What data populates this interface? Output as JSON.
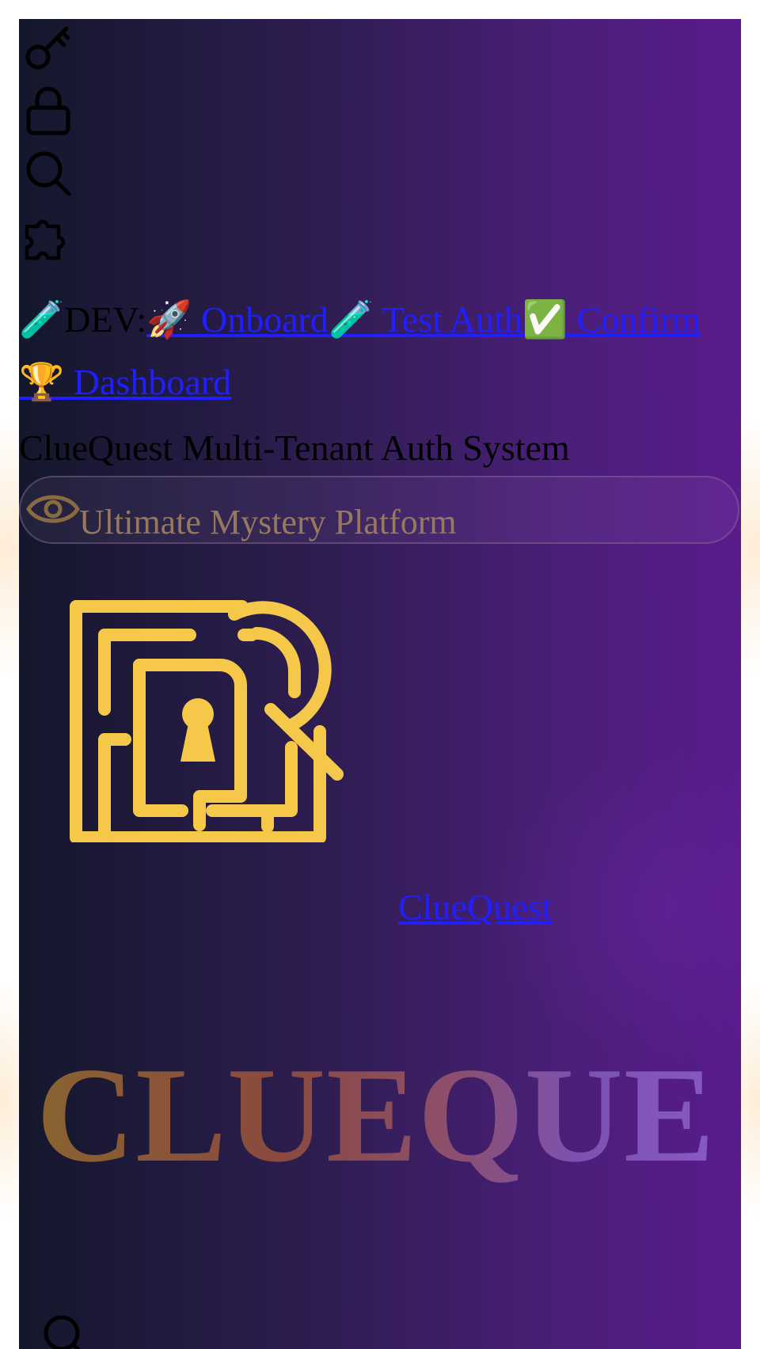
{
  "toolbar_icons": [
    "key-icon",
    "lock-icon",
    "search-icon",
    "puzzle-icon"
  ],
  "dev_nav": {
    "prefix_emoji": "🧪",
    "prefix_label": "DEV:",
    "links": [
      {
        "emoji": "🚀",
        "label": " Onboard"
      },
      {
        "emoji": "🧪",
        "label": " Test Auth"
      },
      {
        "emoji": "✅",
        "label": " Confirm"
      },
      {
        "emoji": "🏆",
        "label": " Dashboard"
      }
    ]
  },
  "header": {
    "system_title": "ClueQuest Multi-Tenant Auth System",
    "tagline": "Ultimate Mystery Platform",
    "tagline_icon": "eye-icon"
  },
  "brand": {
    "logo_icon": "maze-keyhole-magnifier-logo",
    "link_label": "ClueQuest",
    "hero_word": "CLUEQUE"
  },
  "bottom": {
    "icon": "search-icon"
  },
  "colors": {
    "accent_gold": "#f5c84a",
    "link_blue": "#1f1fff",
    "bg_dark": "#14172c",
    "bg_purple": "#5a1b8b"
  }
}
